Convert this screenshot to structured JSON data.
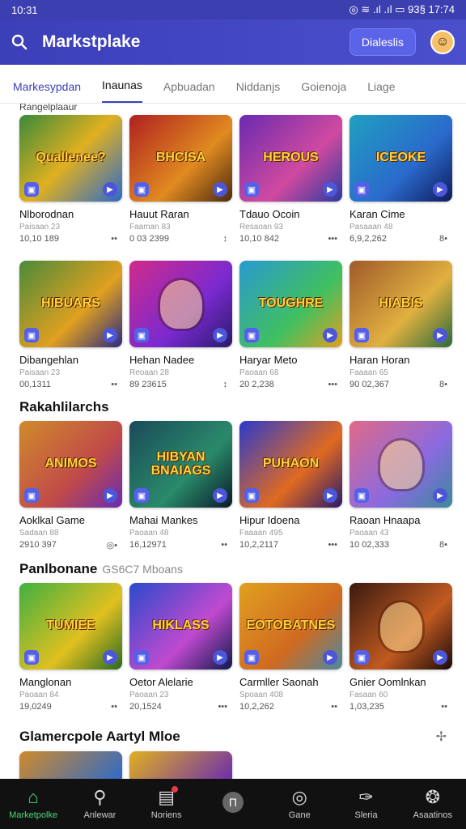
{
  "status": {
    "time": "10:31",
    "right": "◎ ≋ .ıl .ıl ▭ 93§ 17:74"
  },
  "appbar": {
    "title": "Markstplake",
    "button": "Dialeslis",
    "avatar_icon": "user-avatar"
  },
  "tabs": [
    "Markesypdan",
    "Inaunas",
    "Apbuadan",
    "Niddanjs",
    "Goienoja",
    "Liage"
  ],
  "sections": [
    {
      "title": "Rangelplaaur",
      "subtitle": "",
      "cards": [
        {
          "title": "Nlborodnan",
          "sub": "Paisaan 23",
          "left": "10,10 189",
          "right": "••",
          "art": "Quallenee?",
          "bg": "linear-gradient(135deg,#3a8a3a,#e0b020 50%,#2a6acc)"
        },
        {
          "title": "Hauut Raran",
          "sub": "Faaman 83",
          "left": "0 03 2399",
          "right": "↕",
          "art": "BHCISA",
          "bg": "linear-gradient(135deg,#b02020,#e08a20 60%,#4a2a10)"
        },
        {
          "title": "Tdauo Ocoin",
          "sub": "Resaoan 93",
          "left": "10,10 842",
          "right": "•••",
          "art": "HEROUS",
          "bg": "linear-gradient(135deg,#6a2ab0,#d04aa0 60%,#2a3aa0)"
        },
        {
          "title": "Karan Cime",
          "sub": "Pasaaan 48",
          "left": "6,9,2,262",
          "right": "8•",
          "art": "ICEOKE",
          "bg": "linear-gradient(135deg,#20a0c0,#2a6acc 60%,#101a5a)"
        }
      ]
    },
    {
      "title": "",
      "subtitle": "",
      "cards": [
        {
          "title": "Dibangehlan",
          "sub": "Paisaan 23",
          "left": "00,1311",
          "right": "••",
          "art": "HIBUARS",
          "bg": "linear-gradient(135deg,#4a8a3a,#e0a020 60%,#2a2a80)"
        },
        {
          "title": "Hehan Nadee",
          "sub": "Reoaan 28",
          "left": "89 23615",
          "right": "↕",
          "art": "",
          "bg": "linear-gradient(135deg,#d02a8a,#7a2ad0 60%,#2a1a6a)"
        },
        {
          "title": "Haryar Meto",
          "sub": "Paoaan 68",
          "left": "20 2,238",
          "right": "•••",
          "art": "TOUGHRE",
          "bg": "linear-gradient(135deg,#2a9ad0,#40c060 60%,#e0a020)"
        },
        {
          "title": "Haran Horan",
          "sub": "Faaaan 65",
          "left": "90 02,367",
          "right": "8•",
          "art": "HIABIS",
          "bg": "linear-gradient(135deg,#a05a2a,#e0b040 60%,#2a6a3a)"
        }
      ]
    },
    {
      "title": "Rakahlilarchs",
      "subtitle": "",
      "cards": [
        {
          "title": "Aoklkal Game",
          "sub": "Sadaan 88",
          "left": "2910 397",
          "right": "◎•",
          "art": "ANIMOS",
          "bg": "linear-gradient(135deg,#d08a2a,#c04a4a 60%,#6a2ab0)"
        },
        {
          "title": "Mahai Mankes",
          "sub": "Paoaan 48",
          "left": "16,12971",
          "right": "••",
          "art": "HIBYAN BNAIAGS",
          "bg": "linear-gradient(135deg,#1a4a5a,#2a8a6a 60%,#0a1a2a)"
        },
        {
          "title": "Hipur Idoena",
          "sub": "Faaaan 495",
          "left": "10,2,2117",
          "right": "•••",
          "art": "PUHAON",
          "bg": "linear-gradient(135deg,#2a3acc,#e06a20 60%,#2a1a6a)"
        },
        {
          "title": "Raoan Hnaapa",
          "sub": "Paoaan 43",
          "left": "10 02,333",
          "right": "8•",
          "art": "",
          "bg": "linear-gradient(135deg,#e06a8a,#8a6ae0 60%,#3a8a9a)"
        }
      ]
    },
    {
      "title": "Panlbonane",
      "subtitle": "GS6C7 Mboans",
      "cards": [
        {
          "title": "Manglonan",
          "sub": "Paoaan 84",
          "left": "19,0249",
          "right": "••",
          "art": "TUMIEE",
          "bg": "linear-gradient(135deg,#40b040,#e0c020 60%,#2a6a20)"
        },
        {
          "title": "Oetor Alelarie",
          "sub": "Paoaan 23",
          "left": "20,1524",
          "right": "•••",
          "art": "HIKLASS",
          "bg": "linear-gradient(135deg,#2a4acc,#c04ad0 60%,#101a4a)"
        },
        {
          "title": "Carmller Saonah",
          "sub": "Spoaan 408",
          "left": "10,2,262",
          "right": "••",
          "art": "EOTOBATNES",
          "bg": "linear-gradient(135deg,#e0a020,#d06a20 60%,#4a8aa0)"
        },
        {
          "title": "Gnier Oomlnkan",
          "sub": "Fasaan 60",
          "left": "1,03,235",
          "right": "••",
          "art": "",
          "bg": "linear-gradient(135deg,#3a1a10,#c05a20 60%,#1a0a0a)"
        }
      ]
    }
  ],
  "last_section": {
    "title": "Glamercpole Aartyl Mloe"
  },
  "bottom_nav": [
    {
      "label": "Marketpolke",
      "icon": "⌂",
      "active": true
    },
    {
      "label": "Anlewar",
      "icon": "⚲",
      "active": false
    },
    {
      "label": "Noriens",
      "icon": "▤",
      "active": false
    },
    {
      "label": "",
      "icon": "Π",
      "active": false,
      "circle": true
    },
    {
      "label": "Gane",
      "icon": "◎",
      "active": false
    },
    {
      "label": "Sleria",
      "icon": "✑",
      "active": false
    },
    {
      "label": "Asaatinos",
      "icon": "❂",
      "active": false
    }
  ]
}
